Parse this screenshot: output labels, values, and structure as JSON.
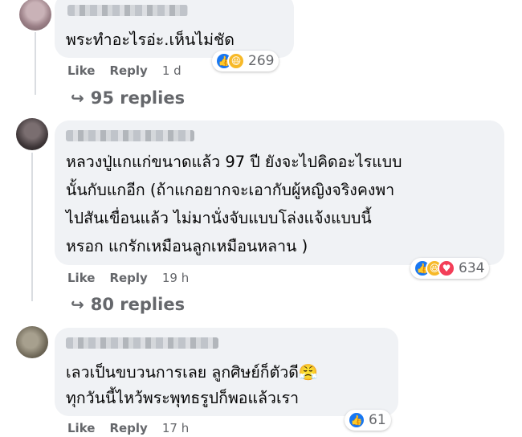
{
  "comments": [
    {
      "text_lines": [
        "พระทำอะไรอ่ะ.เห็นไม่ชัด"
      ],
      "reaction_count": "269",
      "reactions": [
        "like-icon",
        "haha-icon"
      ],
      "like_label": "Like",
      "reply_label": "Reply",
      "time": "1 d",
      "replies_label": "95 replies"
    },
    {
      "text_lines": [
        "หลวงปู่แกแก่ขนาดแล้ว 97 ปี ยังจะไปคิดอะไรแบบ",
        "นั้นกับแกอีก (ถ้าแกอยากจะเอากับผู้หญิงจริงคงพา",
        "ไปสันเขื่อนแล้ว ไม่มานั่งจับแบบโล่งแจ้งแบบนี้",
        "หรอก แกรักเหมือนลูกเหมือนหลาน )"
      ],
      "reaction_count": "634",
      "reactions": [
        "like-icon",
        "haha-icon",
        "love-icon"
      ],
      "like_label": "Like",
      "reply_label": "Reply",
      "time": "19 h",
      "replies_label": "80 replies"
    },
    {
      "text_lines": [
        "เลวเป็นขบวนการเลย ลูกศิษย์ก็ตัวดี😤",
        "ทุกวันนี้ไหว้พระพุทธรูปก็พอแล้วเรา"
      ],
      "reaction_count": "61",
      "reactions": [
        "like-icon"
      ],
      "like_label": "Like",
      "reply_label": "Reply",
      "time": "17 h"
    }
  ],
  "colors": {
    "bubble": "#f0f2f5",
    "secondary_text": "#65676b",
    "like_blue": "#1877f2",
    "haha_yellow": "#f7b928",
    "love_red": "#f33e58"
  }
}
